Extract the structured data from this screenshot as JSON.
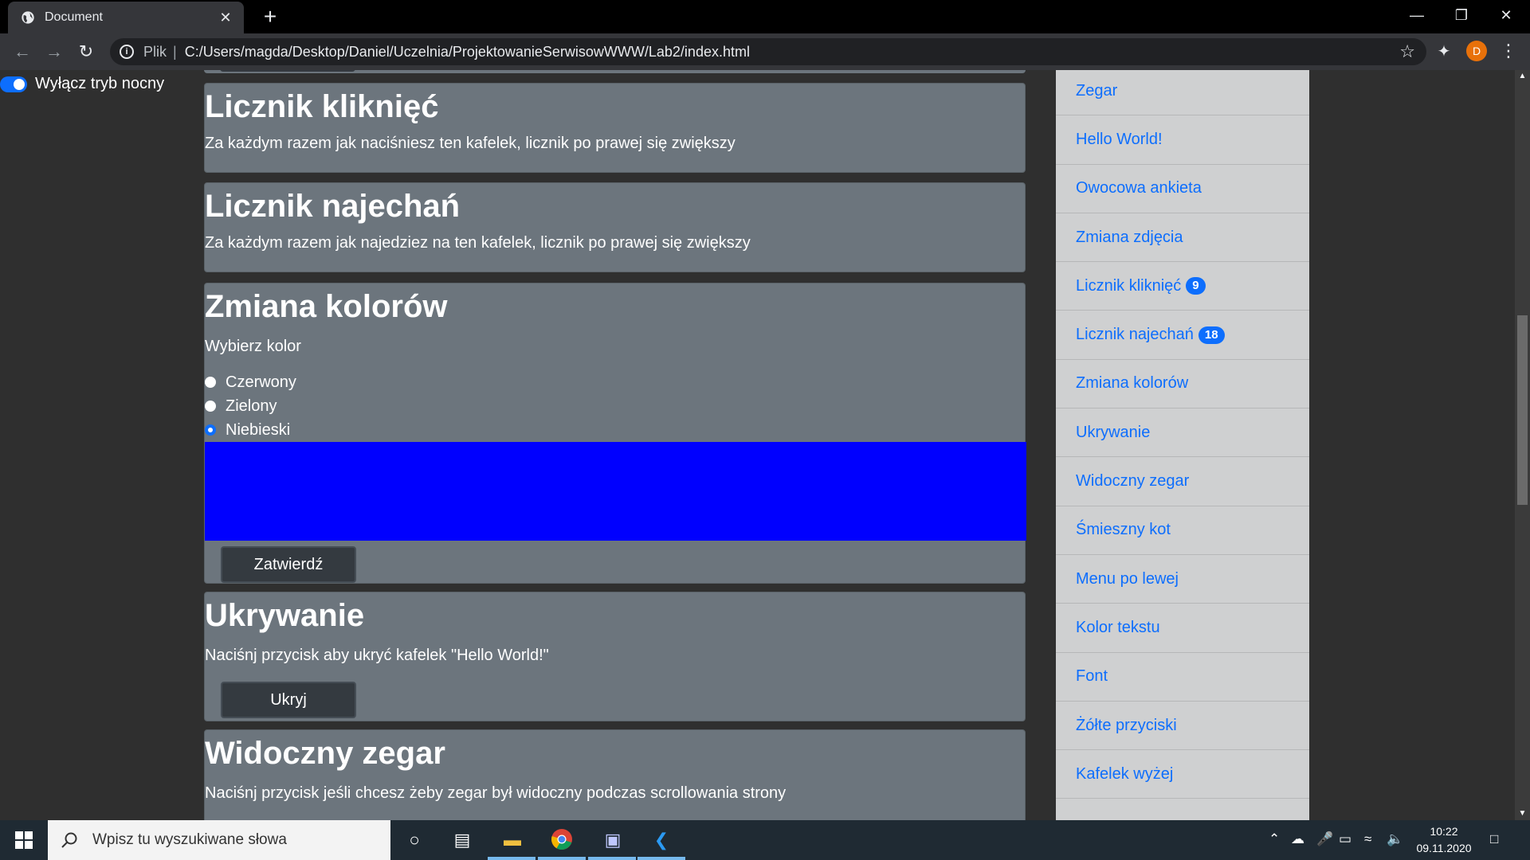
{
  "browser": {
    "tab_title": "Document",
    "tab_close": "✕",
    "new_tab": "+",
    "scheme": "Plik",
    "separator": "|",
    "url": "C:/Users/magda/Desktop/Daniel/Uczelnia/ProjektowanieSerwisowWWW/Lab2/index.html",
    "profile_initial": "D"
  },
  "page": {
    "dark_mode_toggle_label": "Wyłącz tryb nocny",
    "tiles": {
      "click_counter": {
        "title": "Licznik kliknięć",
        "text": "Za każdym razem jak naciśniesz ten kafelek, licznik po prawej się zwiększy"
      },
      "hover_counter": {
        "title": "Licznik najechań",
        "text": "Za każdym razem jak najedziez na ten kafelek, licznik po prawej się zwiększy"
      },
      "color_change": {
        "title": "Zmiana kolorów",
        "prompt": "Wybierz kolor",
        "options": [
          "Czerwony",
          "Zielony",
          "Niebieski"
        ],
        "selected": "Niebieski",
        "selected_color": "#0000ff",
        "submit_label": "Zatwierdź"
      },
      "hiding": {
        "title": "Ukrywanie",
        "text": "Naciśnj przycisk aby ukryć kafelek \"Hello World!\"",
        "button_label": "Ukryj"
      },
      "visible_clock": {
        "title": "Widoczny zegar",
        "text": "Naciśnj przycisk jeśli chcesz żeby zegar był widoczny podczas scrollowania strony"
      }
    },
    "sidebar": {
      "items": [
        {
          "label": "Zegar"
        },
        {
          "label": "Hello World!"
        },
        {
          "label": "Owocowa ankieta"
        },
        {
          "label": "Zmiana zdjęcia"
        },
        {
          "label": "Licznik kliknięć",
          "badge": "9"
        },
        {
          "label": "Licznik najechań",
          "badge": "18"
        },
        {
          "label": "Zmiana kolorów"
        },
        {
          "label": "Ukrywanie"
        },
        {
          "label": "Widoczny zegar"
        },
        {
          "label": "Śmieszny kot"
        },
        {
          "label": "Menu po lewej"
        },
        {
          "label": "Kolor tekstu"
        },
        {
          "label": "Font"
        },
        {
          "label": "Żółte przyciski"
        },
        {
          "label": "Kafelek wyżej"
        }
      ]
    }
  },
  "taskbar": {
    "search_placeholder": "Wpisz tu wyszukiwane słowa",
    "time": "10:22",
    "date": "09.11.2020"
  },
  "colors": {
    "accent": "#0d6efd",
    "tile_bg": "#6c757d",
    "page_bg": "#2f2f2f",
    "sidebar_bg": "#cfd0d1"
  }
}
